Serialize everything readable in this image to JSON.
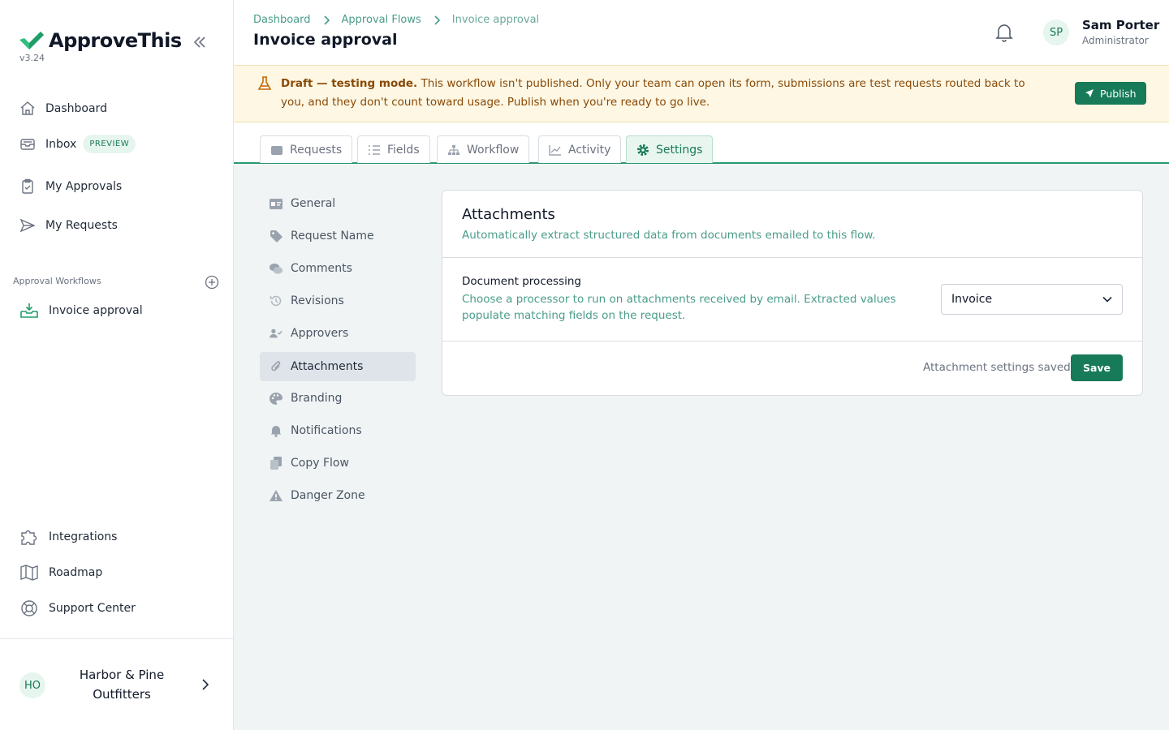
{
  "brand": {
    "name": "ApproveThis",
    "version": "v3.24"
  },
  "sidebar": {
    "nav": [
      {
        "label": "Dashboard"
      },
      {
        "label": "Inbox",
        "badge": "PREVIEW"
      },
      {
        "label": "My Approvals"
      },
      {
        "label": "My Requests"
      }
    ],
    "section_label": "Approval Workflows",
    "workflows": [
      {
        "label": "Invoice approval"
      }
    ],
    "bottom": [
      {
        "label": "Integrations"
      },
      {
        "label": "Roadmap"
      },
      {
        "label": "Support Center"
      }
    ],
    "org": {
      "initials": "HO",
      "name": "Harbor & Pine Outfitters"
    }
  },
  "header": {
    "breadcrumbs": [
      "Dashboard",
      "Approval Flows",
      "Invoice approval"
    ],
    "title": "Invoice approval",
    "user": {
      "initials": "SP",
      "name": "Sam Porter",
      "role": "Administrator"
    }
  },
  "banner": {
    "strong": "Draft — testing mode.",
    "text": " This workflow isn't published. Only your team can open its form, submissions are test requests routed back to you, and they don't count toward usage. Publish when you're ready to go live.",
    "button": "Publish"
  },
  "tabs": [
    {
      "label": "Requests"
    },
    {
      "label": "Fields"
    },
    {
      "label": "Workflow"
    },
    {
      "label": "Activity"
    },
    {
      "label": "Settings",
      "active": true
    }
  ],
  "settings_menu": [
    "General",
    "Request Name",
    "Comments",
    "Revisions",
    "Approvers",
    "Attachments",
    "Branding",
    "Notifications",
    "Copy Flow",
    "Danger Zone"
  ],
  "card": {
    "title": "Attachments",
    "subtitle": "Automatically extract structured data from documents emailed to this flow.",
    "field_label": "Document processing",
    "field_help": "Choose a processor to run on attachments received by email. Extracted values populate matching fields on the request.",
    "select_value": "Invoice",
    "saved_message": "Attachment settings saved.",
    "save_button": "Save"
  },
  "colors": {
    "brand_green": "#177a58",
    "accent_teal": "#4a9c8a",
    "banner_bg": "#fdf7e4"
  }
}
